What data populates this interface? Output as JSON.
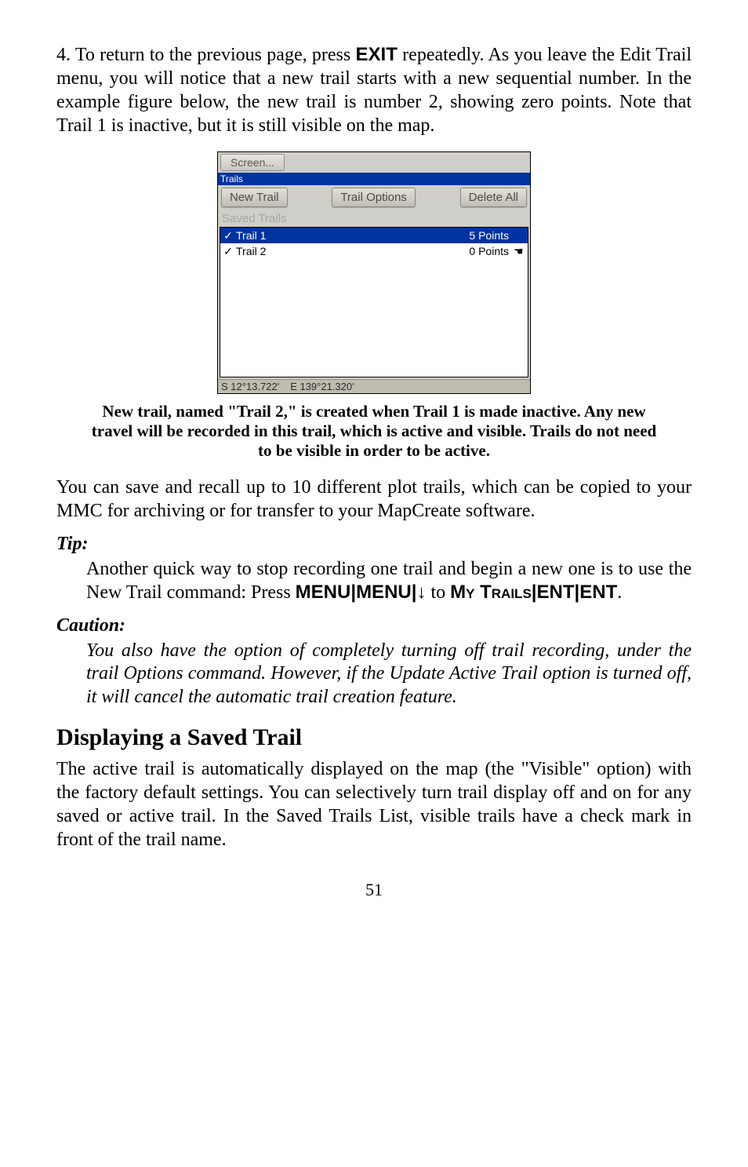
{
  "body": {
    "p1_a": "4. To return to the previous page, press ",
    "p1_key": "EXIT",
    "p1_b": " repeatedly. As you leave the Edit Trail menu, you will notice that a new trail starts with a new sequential number. In the example figure below, the new trail is number 2, showing zero points. Note that Trail 1 is inactive, but it is still visible on the map.",
    "caption": "New trail, named \"Trail 2,\" is created when Trail 1 is made inactive. Any new travel will be recorded in this trail, which is active and visible. Trails do not need to be visible in order to be active.",
    "p2": "You can save and recall up to 10 different plot trails, which can be copied to your MMC for archiving or for transfer to your MapCreate software.",
    "tip_h": "Tip:",
    "tip_a": "Another quick way to stop recording one trail and begin a new one is to use the New Trail command: Press ",
    "tip_k1": "MENU",
    "tip_pipe": "|",
    "tip_k2": "MENU",
    "tip_arrow": "↓",
    "tip_to": " to ",
    "tip_sc1": "My Trails",
    "tip_k3": "ENT",
    "tip_k4": "ENT",
    "tip_end": ".",
    "caution_h": "Caution:",
    "caution_body": "You also have the option of completely turning off trail recording, under the trail Options command. However, if the Update Active Trail option is turned off, it will cancel the automatic trail creation feature.",
    "section": "Displaying a Saved Trail",
    "p3": "The active trail is automatically displayed on the map (the \"Visible\" option) with the factory default settings. You can selectively turn trail display off and on for any saved or active trail. In the Saved Trails List, visible trails have a check mark in front of the trail name.",
    "pagenum": "51"
  },
  "fig": {
    "screen_btn": "Screen...",
    "title": "Trails",
    "new_trail": "New Trail",
    "trail_options": "Trail Options",
    "delete_all": "Delete All",
    "saved_trails": "Saved Trails",
    "rows": [
      {
        "name": "Trail 1",
        "pts": "5 Points",
        "selected": true,
        "check": "✓",
        "hand": ""
      },
      {
        "name": "Trail 2",
        "pts": "0 Points",
        "selected": false,
        "check": "✓",
        "hand": "☚"
      }
    ],
    "lat": "S   12°13.722'",
    "lon": "E  139°21.320'"
  }
}
